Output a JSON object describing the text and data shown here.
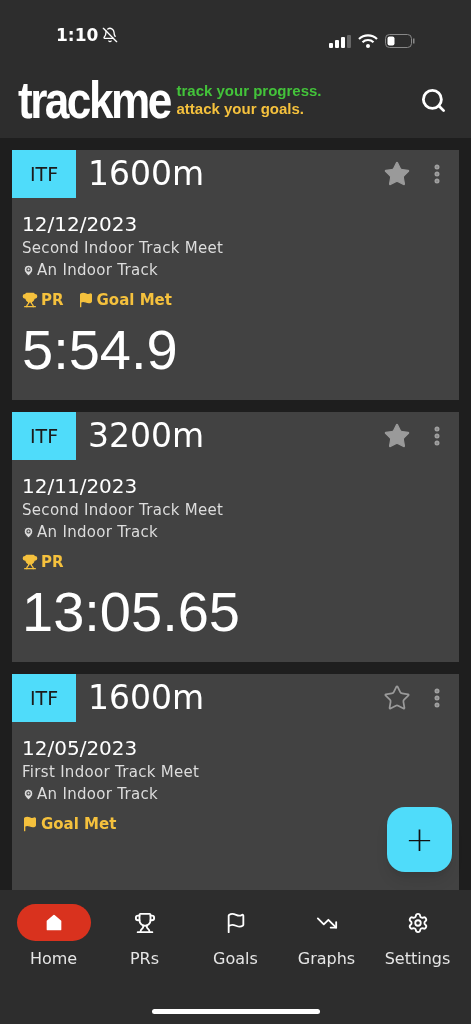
{
  "status_bar": {
    "time": "1:10"
  },
  "header": {
    "logo": "trackme",
    "tagline_1": "track your progress.",
    "tagline_2": "attack your goals."
  },
  "results": [
    {
      "tag": "ITF",
      "event": "1600m",
      "starred": true,
      "date": "12/12/2023",
      "meet": "Second Indoor Track Meet",
      "location": "An Indoor Track",
      "badges": [
        {
          "kind": "pr",
          "label": "PR"
        },
        {
          "kind": "goal",
          "label": "Goal Met"
        }
      ],
      "time": "5:54.9"
    },
    {
      "tag": "ITF",
      "event": "3200m",
      "starred": true,
      "date": "12/11/2023",
      "meet": "Second Indoor Track Meet",
      "location": "An Indoor Track",
      "badges": [
        {
          "kind": "pr",
          "label": "PR"
        }
      ],
      "time": "13:05.65"
    },
    {
      "tag": "ITF",
      "event": "1600m",
      "starred": false,
      "date": "12/05/2023",
      "meet": "First Indoor Track Meet",
      "location": "An Indoor Track",
      "badges": [
        {
          "kind": "goal",
          "label": "Goal Met"
        }
      ]
    }
  ],
  "fab": {
    "label": "+"
  },
  "nav": [
    {
      "kind": "home",
      "label": "Home",
      "selected": true
    },
    {
      "kind": "prs",
      "label": "PRs",
      "selected": false
    },
    {
      "kind": "goals",
      "label": "Goals",
      "selected": false
    },
    {
      "kind": "graphs",
      "label": "Graphs",
      "selected": false
    },
    {
      "kind": "settings",
      "label": "Settings",
      "selected": false
    }
  ]
}
